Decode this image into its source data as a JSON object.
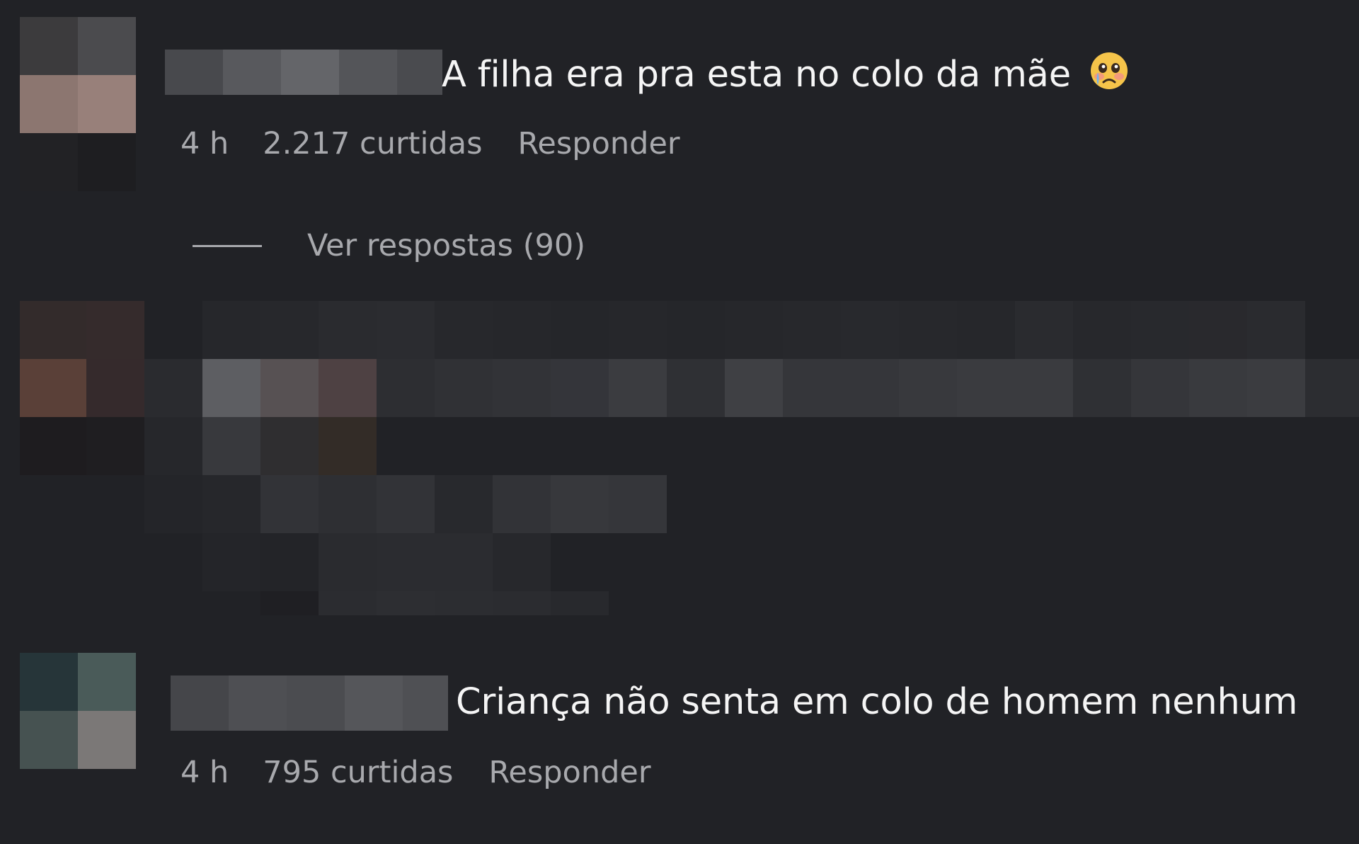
{
  "comments": [
    {
      "text": "A filha era pra esta no colo da mãe",
      "emoji": "pleading-crying-face-icon",
      "time": "4 h",
      "likes": "2.217 curtidas",
      "reply_label": "Responder",
      "view_replies": "Ver respostas (90)"
    },
    {
      "text": "Criança não senta em colo de homem nenhum",
      "time": "4 h",
      "likes": "795 curtidas",
      "reply_label": "Responder"
    }
  ],
  "colors": {
    "background": "#212226",
    "text_primary": "#f5f5f5",
    "text_secondary": "#a8a9ad"
  }
}
